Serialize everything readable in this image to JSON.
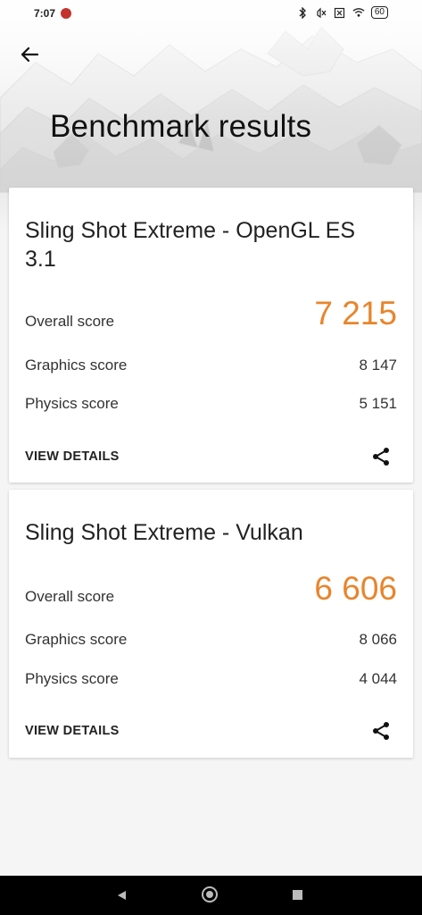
{
  "status": {
    "time": "7:07",
    "battery": "60"
  },
  "header": {
    "title": "Benchmark results"
  },
  "cards": [
    {
      "title": "Sling Shot Extreme - OpenGL ES 3.1",
      "overall_label": "Overall score",
      "overall_value": "7 215",
      "graphics_label": "Graphics score",
      "graphics_value": "8 147",
      "physics_label": "Physics score",
      "physics_value": "5 151",
      "view_details": "VIEW DETAILS"
    },
    {
      "title": "Sling Shot Extreme - Vulkan",
      "overall_label": "Overall score",
      "overall_value": "6 606",
      "graphics_label": "Graphics score",
      "graphics_value": "8 066",
      "physics_label": "Physics score",
      "physics_value": "4 044",
      "view_details": "VIEW DETAILS"
    }
  ],
  "icons": {
    "back": "arrow-left-icon",
    "share": "share-icon"
  },
  "colors": {
    "accent": "#e8852c",
    "background": "#f5f5f5",
    "card": "#ffffff",
    "navbar": "#000000"
  }
}
